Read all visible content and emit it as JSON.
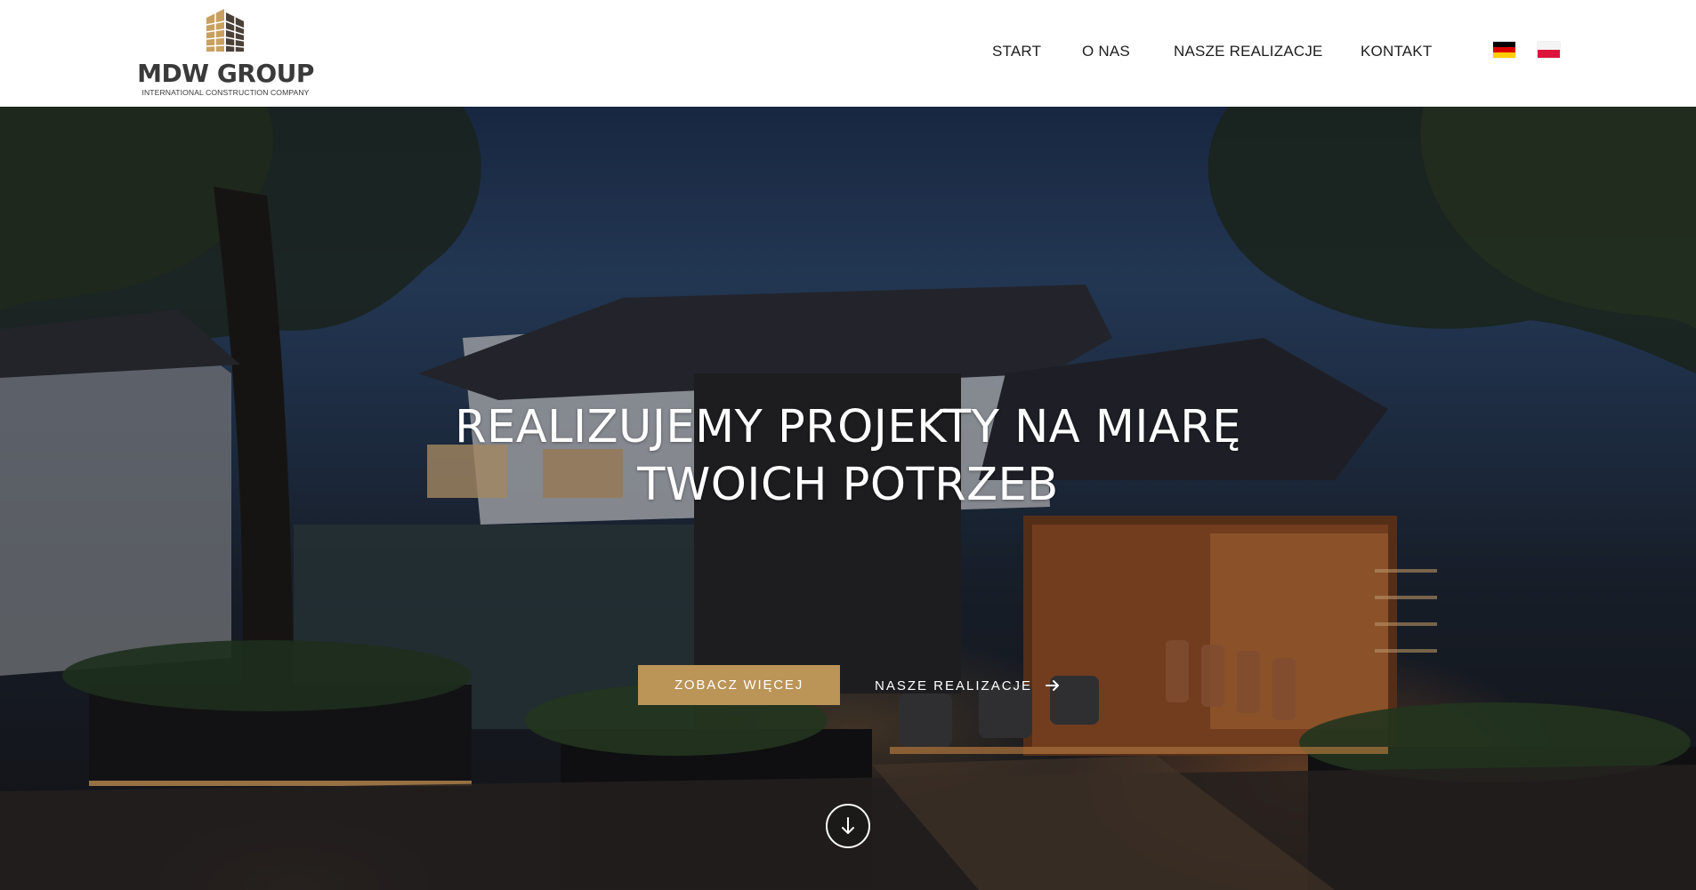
{
  "brand": {
    "name": "MDW GROUP",
    "tagline": "INTERNATIONAL CONSTRUCTION COMPANY",
    "mark_colors": {
      "light": "#c8a060",
      "dark": "#4a4038"
    }
  },
  "nav": {
    "items": [
      {
        "label": "START"
      },
      {
        "label": "O NAS"
      },
      {
        "label": "NASZE REALIZACJE"
      },
      {
        "label": "KONTAKT"
      }
    ],
    "languages": [
      {
        "icon": "flag-germany-icon"
      },
      {
        "icon": "flag-poland-icon"
      }
    ]
  },
  "hero": {
    "title_line1": "REALIZUJEMY PROJEKTY NA MIARĘ",
    "title_line2": "TWOICH POTRZEB",
    "primary_button": "ZOBACZ WIĘCEJ",
    "secondary_button": "NASZE REALIZACJE",
    "secondary_icon": "arrow-right-icon",
    "scroll_icon": "arrow-down-icon"
  },
  "colors": {
    "accent": "#bb9458",
    "nav_text": "#1e1e1e",
    "logo_text": "#3a3a3a",
    "hero_text": "#ffffff"
  }
}
